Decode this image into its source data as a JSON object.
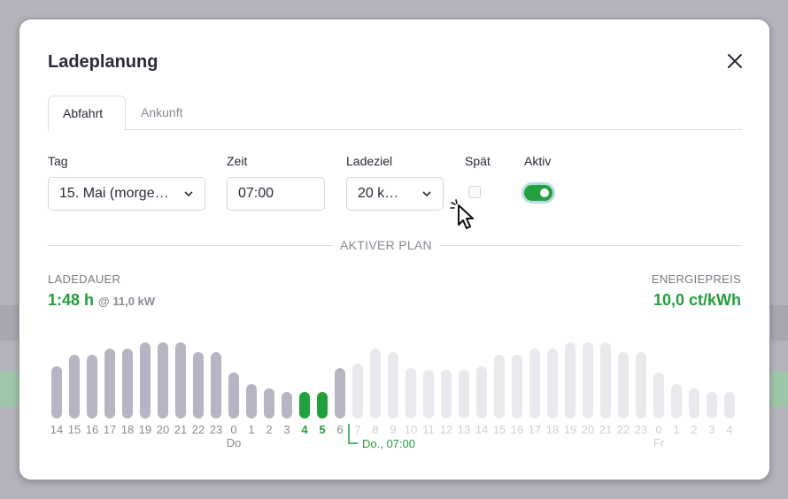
{
  "dialog": {
    "title": "Ladeplanung",
    "close_icon": "close-icon"
  },
  "tabs": [
    {
      "label": "Abfahrt",
      "active": true
    },
    {
      "label": "Ankunft",
      "active": false
    }
  ],
  "form": {
    "tag": {
      "label": "Tag",
      "value": "15. Mai (morge…"
    },
    "zeit": {
      "label": "Zeit",
      "value": "07:00"
    },
    "ladeziel": {
      "label": "Ladeziel",
      "value": "20 k…"
    },
    "spaet": {
      "label": "Spät",
      "checked": false
    },
    "aktiv": {
      "label": "Aktiv",
      "on": true
    }
  },
  "plan": {
    "divider_label": "AKTIVER PLAN",
    "ladedauer_label": "LADEDAUER",
    "ladedauer_value": "1:48 h",
    "ladedauer_power": "@ 11,0 kW",
    "energiepreis_label": "ENERGIEPREIS",
    "energiepreis_value": "10,0 ct/kWh"
  },
  "colors": {
    "accent": "#1fa13b",
    "bar_active": "#b6b6c2",
    "bar_future": "#e9e9ed",
    "label_active": "#8a8a94",
    "label_future": "#d0d0d6"
  },
  "chart_data": {
    "type": "bar",
    "categories": [
      "14",
      "15",
      "16",
      "17",
      "18",
      "19",
      "20",
      "21",
      "22",
      "23",
      "0",
      "1",
      "2",
      "3",
      "4",
      "5",
      "6",
      "7",
      "8",
      "9",
      "10",
      "11",
      "12",
      "13",
      "14",
      "15",
      "16",
      "17",
      "18",
      "19",
      "20",
      "21",
      "22",
      "23",
      "0",
      "1",
      "2",
      "3",
      "4"
    ],
    "values": [
      59,
      72,
      72,
      79,
      79,
      86,
      86,
      86,
      75,
      75,
      52,
      39,
      34,
      30,
      30,
      30,
      57,
      62,
      79,
      75,
      57,
      55,
      55,
      55,
      59,
      72,
      72,
      79,
      79,
      86,
      86,
      86,
      75,
      75,
      52,
      39,
      34,
      30,
      30
    ],
    "charging_indices": [
      14,
      15
    ],
    "past_count": 17,
    "day_labels": [
      {
        "index": 10,
        "label": "Do"
      },
      {
        "index": 34,
        "label": "Fr"
      }
    ],
    "departure_index": 17,
    "departure_label": "Do., 07:00"
  }
}
